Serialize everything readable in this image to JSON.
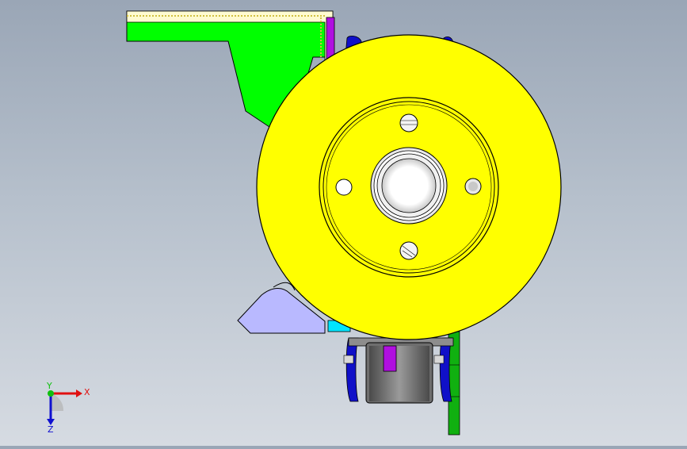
{
  "viewport": {
    "colors": {
      "background_top": "#9aa6b6",
      "background_bottom": "#d6dbe2",
      "disc": "#ffff00",
      "bracket_top": "#00ff00",
      "bracket_bottom": "#b9b9ff",
      "caliper_blue": "#1010c8",
      "caliper_purple": "#b010e0",
      "hub_gray": "#707070",
      "green_plate": "#10b010",
      "cyan_part": "#00e5ff"
    },
    "parts": [
      {
        "name": "brake-disc",
        "icon": "disc-icon"
      },
      {
        "name": "mounting-bracket-top",
        "icon": "bracket-icon"
      },
      {
        "name": "mounting-bracket-bottom",
        "icon": "bracket-icon"
      },
      {
        "name": "caliper-assembly",
        "icon": "caliper-icon"
      },
      {
        "name": "hub-cylinder",
        "icon": "cylinder-icon"
      }
    ]
  },
  "triad": {
    "x_label": "X",
    "y_label": "Y",
    "z_label": "Z",
    "x_color": "#e01010",
    "y_color": "#10c010",
    "z_color": "#1010d0"
  }
}
